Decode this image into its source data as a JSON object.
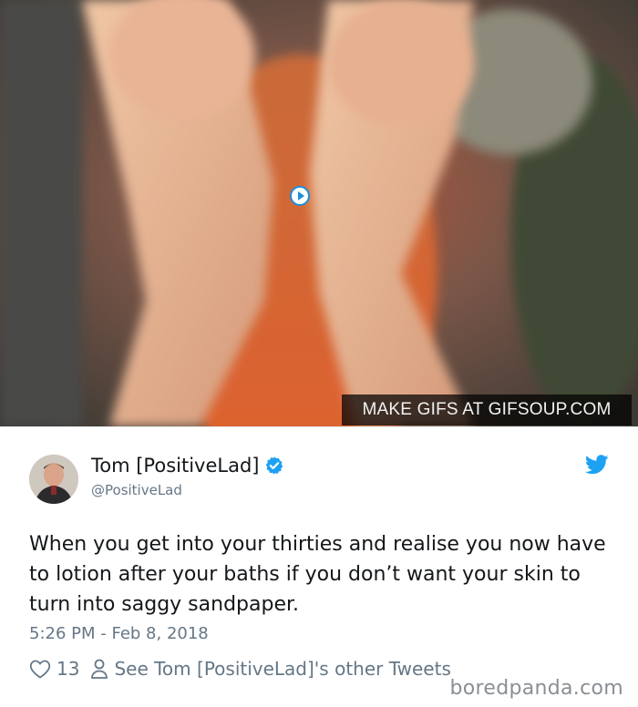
{
  "media": {
    "watermark": "MAKE GIFS AT GIFSOUP.COM",
    "play_icon": "play-icon"
  },
  "tweet": {
    "display_name": "Tom [PositiveLad]",
    "handle": "@PositiveLad",
    "text": "When you get into your thirties and realise you now have to lotion after your baths if you don’t want your skin to turn into saggy sandpaper.",
    "timestamp": "5:26 PM - Feb 8, 2018",
    "likes": "13",
    "other_tweets_link": "See Tom [PositiveLad]'s other Tweets"
  },
  "icons": {
    "verified": "verified-badge-icon",
    "bird": "twitter-bird-icon",
    "heart": "heart-icon",
    "person": "person-icon"
  },
  "colors": {
    "twitter_blue": "#1da1f2",
    "secondary_text": "#657786",
    "primary_text": "#14171a"
  },
  "footer": {
    "brand": "boredpanda.com"
  }
}
